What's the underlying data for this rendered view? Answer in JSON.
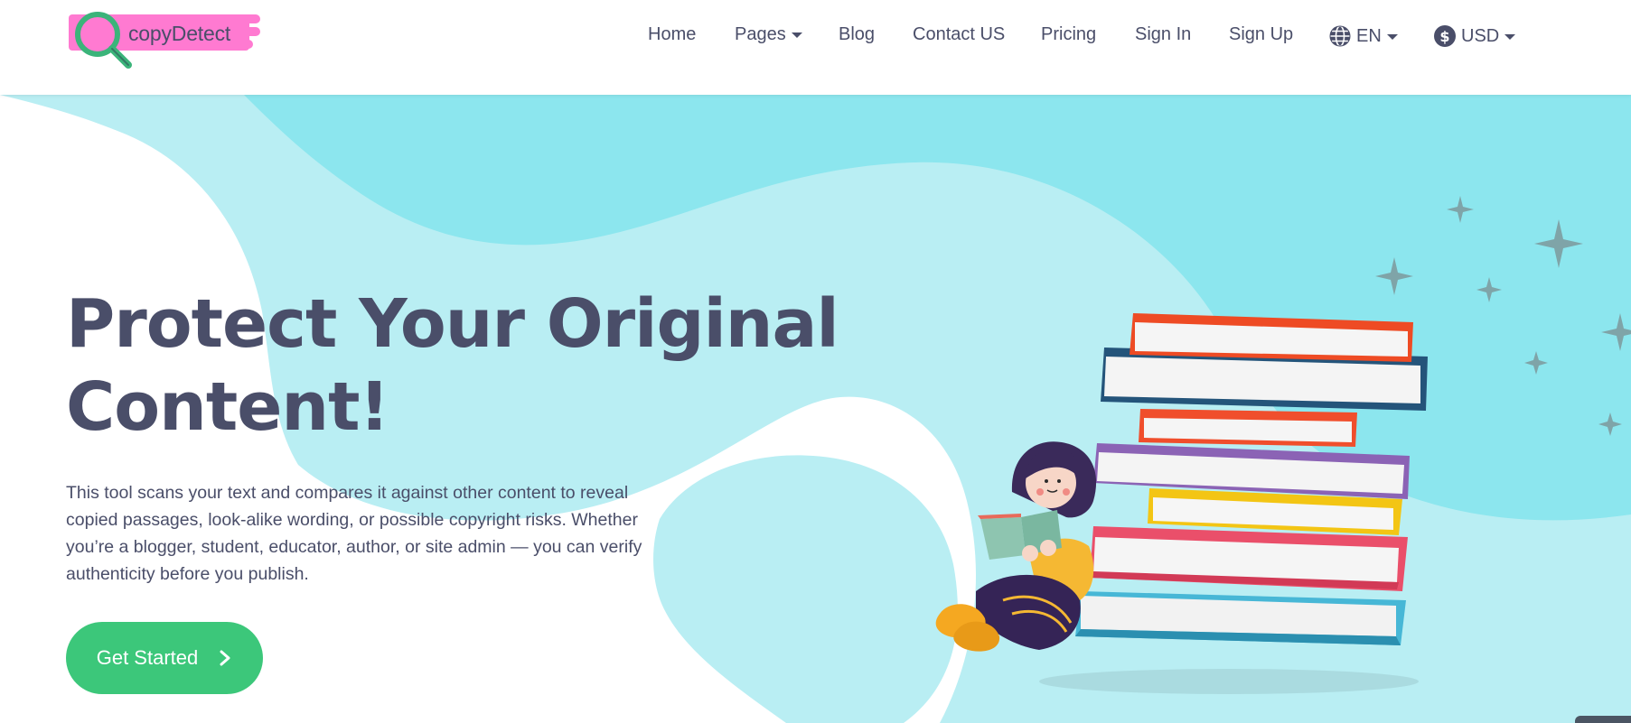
{
  "brand": {
    "name": "copyDetect",
    "logo_icon": "magnifier-logo-icon",
    "colors": {
      "pink": "#ff7ad1",
      "green": "#3bb47a"
    }
  },
  "nav": {
    "items": [
      {
        "label": "Home"
      },
      {
        "label": "Pages"
      },
      {
        "label": "Blog"
      },
      {
        "label": "Contact US"
      },
      {
        "label": "Pricing"
      },
      {
        "label": "Sign In"
      },
      {
        "label": "Sign Up"
      }
    ],
    "language": {
      "label": "EN",
      "icon": "globe-icon"
    },
    "currency": {
      "label": "USD",
      "icon": "dollar-icon"
    }
  },
  "hero": {
    "headline_line1": "Protect Your Original",
    "headline_line2": "Content!",
    "description": "This tool scans your text and compares it against other content to reveal copied passages, look-alike wording, or possible copyright risks. Whether you’re a blogger, student, educator, author, or site admin — you can verify authenticity before you publish.",
    "cta_label": "Get Started",
    "cta_icon": "chevron-right-icon"
  },
  "theme": {
    "text": "#4a4e69",
    "accent": "#3cc77a",
    "blob_dark": "#8ce6ee",
    "blob_light": "#b9eef3"
  }
}
